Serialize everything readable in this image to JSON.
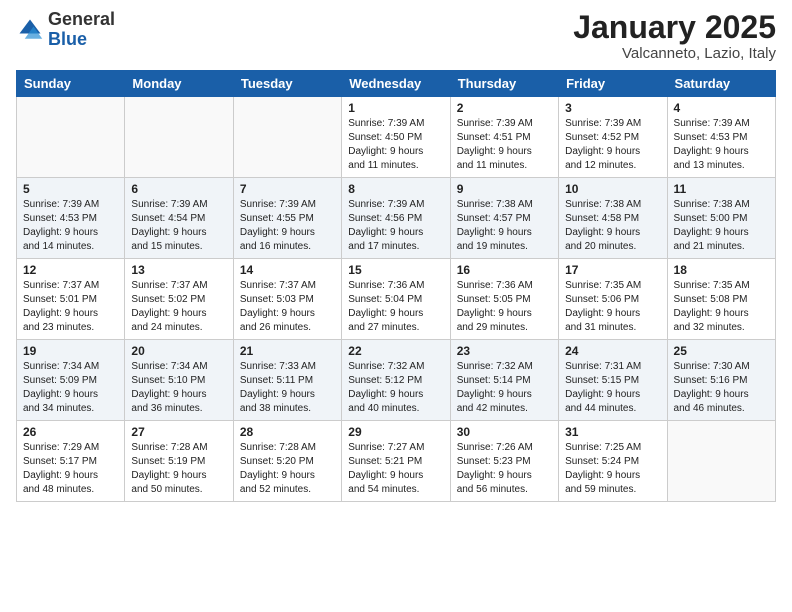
{
  "logo": {
    "general": "General",
    "blue": "Blue"
  },
  "header": {
    "month": "January 2025",
    "location": "Valcanneto, Lazio, Italy"
  },
  "weekdays": [
    "Sunday",
    "Monday",
    "Tuesday",
    "Wednesday",
    "Thursday",
    "Friday",
    "Saturday"
  ],
  "weeks": [
    [
      {
        "day": "",
        "info": ""
      },
      {
        "day": "",
        "info": ""
      },
      {
        "day": "",
        "info": ""
      },
      {
        "day": "1",
        "info": "Sunrise: 7:39 AM\nSunset: 4:50 PM\nDaylight: 9 hours\nand 11 minutes."
      },
      {
        "day": "2",
        "info": "Sunrise: 7:39 AM\nSunset: 4:51 PM\nDaylight: 9 hours\nand 11 minutes."
      },
      {
        "day": "3",
        "info": "Sunrise: 7:39 AM\nSunset: 4:52 PM\nDaylight: 9 hours\nand 12 minutes."
      },
      {
        "day": "4",
        "info": "Sunrise: 7:39 AM\nSunset: 4:53 PM\nDaylight: 9 hours\nand 13 minutes."
      }
    ],
    [
      {
        "day": "5",
        "info": "Sunrise: 7:39 AM\nSunset: 4:53 PM\nDaylight: 9 hours\nand 14 minutes."
      },
      {
        "day": "6",
        "info": "Sunrise: 7:39 AM\nSunset: 4:54 PM\nDaylight: 9 hours\nand 15 minutes."
      },
      {
        "day": "7",
        "info": "Sunrise: 7:39 AM\nSunset: 4:55 PM\nDaylight: 9 hours\nand 16 minutes."
      },
      {
        "day": "8",
        "info": "Sunrise: 7:39 AM\nSunset: 4:56 PM\nDaylight: 9 hours\nand 17 minutes."
      },
      {
        "day": "9",
        "info": "Sunrise: 7:38 AM\nSunset: 4:57 PM\nDaylight: 9 hours\nand 19 minutes."
      },
      {
        "day": "10",
        "info": "Sunrise: 7:38 AM\nSunset: 4:58 PM\nDaylight: 9 hours\nand 20 minutes."
      },
      {
        "day": "11",
        "info": "Sunrise: 7:38 AM\nSunset: 5:00 PM\nDaylight: 9 hours\nand 21 minutes."
      }
    ],
    [
      {
        "day": "12",
        "info": "Sunrise: 7:37 AM\nSunset: 5:01 PM\nDaylight: 9 hours\nand 23 minutes."
      },
      {
        "day": "13",
        "info": "Sunrise: 7:37 AM\nSunset: 5:02 PM\nDaylight: 9 hours\nand 24 minutes."
      },
      {
        "day": "14",
        "info": "Sunrise: 7:37 AM\nSunset: 5:03 PM\nDaylight: 9 hours\nand 26 minutes."
      },
      {
        "day": "15",
        "info": "Sunrise: 7:36 AM\nSunset: 5:04 PM\nDaylight: 9 hours\nand 27 minutes."
      },
      {
        "day": "16",
        "info": "Sunrise: 7:36 AM\nSunset: 5:05 PM\nDaylight: 9 hours\nand 29 minutes."
      },
      {
        "day": "17",
        "info": "Sunrise: 7:35 AM\nSunset: 5:06 PM\nDaylight: 9 hours\nand 31 minutes."
      },
      {
        "day": "18",
        "info": "Sunrise: 7:35 AM\nSunset: 5:08 PM\nDaylight: 9 hours\nand 32 minutes."
      }
    ],
    [
      {
        "day": "19",
        "info": "Sunrise: 7:34 AM\nSunset: 5:09 PM\nDaylight: 9 hours\nand 34 minutes."
      },
      {
        "day": "20",
        "info": "Sunrise: 7:34 AM\nSunset: 5:10 PM\nDaylight: 9 hours\nand 36 minutes."
      },
      {
        "day": "21",
        "info": "Sunrise: 7:33 AM\nSunset: 5:11 PM\nDaylight: 9 hours\nand 38 minutes."
      },
      {
        "day": "22",
        "info": "Sunrise: 7:32 AM\nSunset: 5:12 PM\nDaylight: 9 hours\nand 40 minutes."
      },
      {
        "day": "23",
        "info": "Sunrise: 7:32 AM\nSunset: 5:14 PM\nDaylight: 9 hours\nand 42 minutes."
      },
      {
        "day": "24",
        "info": "Sunrise: 7:31 AM\nSunset: 5:15 PM\nDaylight: 9 hours\nand 44 minutes."
      },
      {
        "day": "25",
        "info": "Sunrise: 7:30 AM\nSunset: 5:16 PM\nDaylight: 9 hours\nand 46 minutes."
      }
    ],
    [
      {
        "day": "26",
        "info": "Sunrise: 7:29 AM\nSunset: 5:17 PM\nDaylight: 9 hours\nand 48 minutes."
      },
      {
        "day": "27",
        "info": "Sunrise: 7:28 AM\nSunset: 5:19 PM\nDaylight: 9 hours\nand 50 minutes."
      },
      {
        "day": "28",
        "info": "Sunrise: 7:28 AM\nSunset: 5:20 PM\nDaylight: 9 hours\nand 52 minutes."
      },
      {
        "day": "29",
        "info": "Sunrise: 7:27 AM\nSunset: 5:21 PM\nDaylight: 9 hours\nand 54 minutes."
      },
      {
        "day": "30",
        "info": "Sunrise: 7:26 AM\nSunset: 5:23 PM\nDaylight: 9 hours\nand 56 minutes."
      },
      {
        "day": "31",
        "info": "Sunrise: 7:25 AM\nSunset: 5:24 PM\nDaylight: 9 hours\nand 59 minutes."
      },
      {
        "day": "",
        "info": ""
      }
    ]
  ]
}
